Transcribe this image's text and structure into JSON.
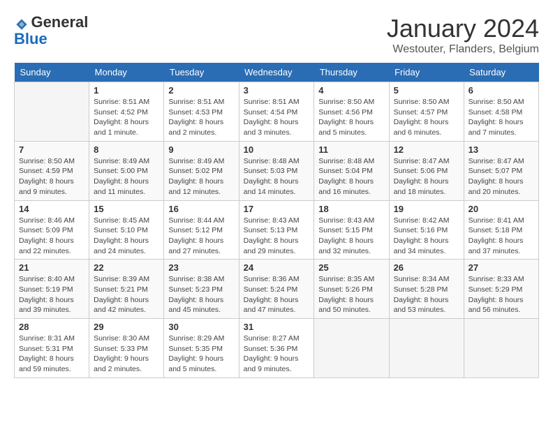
{
  "logo": {
    "general": "General",
    "blue": "Blue"
  },
  "header": {
    "month_year": "January 2024",
    "location": "Westouter, Flanders, Belgium"
  },
  "weekdays": [
    "Sunday",
    "Monday",
    "Tuesday",
    "Wednesday",
    "Thursday",
    "Friday",
    "Saturday"
  ],
  "weeks": [
    [
      {
        "day": "",
        "sunrise": "",
        "sunset": "",
        "daylight": ""
      },
      {
        "day": "1",
        "sunrise": "Sunrise: 8:51 AM",
        "sunset": "Sunset: 4:52 PM",
        "daylight": "Daylight: 8 hours and 1 minute."
      },
      {
        "day": "2",
        "sunrise": "Sunrise: 8:51 AM",
        "sunset": "Sunset: 4:53 PM",
        "daylight": "Daylight: 8 hours and 2 minutes."
      },
      {
        "day": "3",
        "sunrise": "Sunrise: 8:51 AM",
        "sunset": "Sunset: 4:54 PM",
        "daylight": "Daylight: 8 hours and 3 minutes."
      },
      {
        "day": "4",
        "sunrise": "Sunrise: 8:50 AM",
        "sunset": "Sunset: 4:56 PM",
        "daylight": "Daylight: 8 hours and 5 minutes."
      },
      {
        "day": "5",
        "sunrise": "Sunrise: 8:50 AM",
        "sunset": "Sunset: 4:57 PM",
        "daylight": "Daylight: 8 hours and 6 minutes."
      },
      {
        "day": "6",
        "sunrise": "Sunrise: 8:50 AM",
        "sunset": "Sunset: 4:58 PM",
        "daylight": "Daylight: 8 hours and 7 minutes."
      }
    ],
    [
      {
        "day": "7",
        "sunrise": "Sunrise: 8:50 AM",
        "sunset": "Sunset: 4:59 PM",
        "daylight": "Daylight: 8 hours and 9 minutes."
      },
      {
        "day": "8",
        "sunrise": "Sunrise: 8:49 AM",
        "sunset": "Sunset: 5:00 PM",
        "daylight": "Daylight: 8 hours and 11 minutes."
      },
      {
        "day": "9",
        "sunrise": "Sunrise: 8:49 AM",
        "sunset": "Sunset: 5:02 PM",
        "daylight": "Daylight: 8 hours and 12 minutes."
      },
      {
        "day": "10",
        "sunrise": "Sunrise: 8:48 AM",
        "sunset": "Sunset: 5:03 PM",
        "daylight": "Daylight: 8 hours and 14 minutes."
      },
      {
        "day": "11",
        "sunrise": "Sunrise: 8:48 AM",
        "sunset": "Sunset: 5:04 PM",
        "daylight": "Daylight: 8 hours and 16 minutes."
      },
      {
        "day": "12",
        "sunrise": "Sunrise: 8:47 AM",
        "sunset": "Sunset: 5:06 PM",
        "daylight": "Daylight: 8 hours and 18 minutes."
      },
      {
        "day": "13",
        "sunrise": "Sunrise: 8:47 AM",
        "sunset": "Sunset: 5:07 PM",
        "daylight": "Daylight: 8 hours and 20 minutes."
      }
    ],
    [
      {
        "day": "14",
        "sunrise": "Sunrise: 8:46 AM",
        "sunset": "Sunset: 5:09 PM",
        "daylight": "Daylight: 8 hours and 22 minutes."
      },
      {
        "day": "15",
        "sunrise": "Sunrise: 8:45 AM",
        "sunset": "Sunset: 5:10 PM",
        "daylight": "Daylight: 8 hours and 24 minutes."
      },
      {
        "day": "16",
        "sunrise": "Sunrise: 8:44 AM",
        "sunset": "Sunset: 5:12 PM",
        "daylight": "Daylight: 8 hours and 27 minutes."
      },
      {
        "day": "17",
        "sunrise": "Sunrise: 8:43 AM",
        "sunset": "Sunset: 5:13 PM",
        "daylight": "Daylight: 8 hours and 29 minutes."
      },
      {
        "day": "18",
        "sunrise": "Sunrise: 8:43 AM",
        "sunset": "Sunset: 5:15 PM",
        "daylight": "Daylight: 8 hours and 32 minutes."
      },
      {
        "day": "19",
        "sunrise": "Sunrise: 8:42 AM",
        "sunset": "Sunset: 5:16 PM",
        "daylight": "Daylight: 8 hours and 34 minutes."
      },
      {
        "day": "20",
        "sunrise": "Sunrise: 8:41 AM",
        "sunset": "Sunset: 5:18 PM",
        "daylight": "Daylight: 8 hours and 37 minutes."
      }
    ],
    [
      {
        "day": "21",
        "sunrise": "Sunrise: 8:40 AM",
        "sunset": "Sunset: 5:19 PM",
        "daylight": "Daylight: 8 hours and 39 minutes."
      },
      {
        "day": "22",
        "sunrise": "Sunrise: 8:39 AM",
        "sunset": "Sunset: 5:21 PM",
        "daylight": "Daylight: 8 hours and 42 minutes."
      },
      {
        "day": "23",
        "sunrise": "Sunrise: 8:38 AM",
        "sunset": "Sunset: 5:23 PM",
        "daylight": "Daylight: 8 hours and 45 minutes."
      },
      {
        "day": "24",
        "sunrise": "Sunrise: 8:36 AM",
        "sunset": "Sunset: 5:24 PM",
        "daylight": "Daylight: 8 hours and 47 minutes."
      },
      {
        "day": "25",
        "sunrise": "Sunrise: 8:35 AM",
        "sunset": "Sunset: 5:26 PM",
        "daylight": "Daylight: 8 hours and 50 minutes."
      },
      {
        "day": "26",
        "sunrise": "Sunrise: 8:34 AM",
        "sunset": "Sunset: 5:28 PM",
        "daylight": "Daylight: 8 hours and 53 minutes."
      },
      {
        "day": "27",
        "sunrise": "Sunrise: 8:33 AM",
        "sunset": "Sunset: 5:29 PM",
        "daylight": "Daylight: 8 hours and 56 minutes."
      }
    ],
    [
      {
        "day": "28",
        "sunrise": "Sunrise: 8:31 AM",
        "sunset": "Sunset: 5:31 PM",
        "daylight": "Daylight: 8 hours and 59 minutes."
      },
      {
        "day": "29",
        "sunrise": "Sunrise: 8:30 AM",
        "sunset": "Sunset: 5:33 PM",
        "daylight": "Daylight: 9 hours and 2 minutes."
      },
      {
        "day": "30",
        "sunrise": "Sunrise: 8:29 AM",
        "sunset": "Sunset: 5:35 PM",
        "daylight": "Daylight: 9 hours and 5 minutes."
      },
      {
        "day": "31",
        "sunrise": "Sunrise: 8:27 AM",
        "sunset": "Sunset: 5:36 PM",
        "daylight": "Daylight: 9 hours and 9 minutes."
      },
      {
        "day": "",
        "sunrise": "",
        "sunset": "",
        "daylight": ""
      },
      {
        "day": "",
        "sunrise": "",
        "sunset": "",
        "daylight": ""
      },
      {
        "day": "",
        "sunrise": "",
        "sunset": "",
        "daylight": ""
      }
    ]
  ]
}
